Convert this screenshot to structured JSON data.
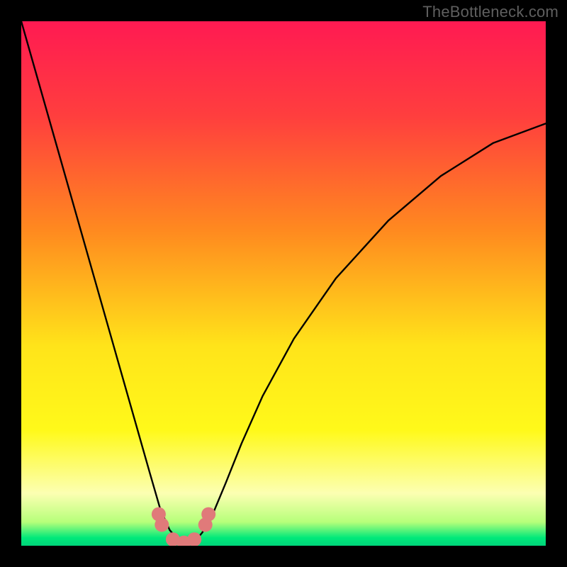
{
  "watermark": "TheBottleneck.com",
  "chart_data": {
    "type": "line",
    "title": "",
    "xlabel": "",
    "ylabel": "",
    "xlim": [
      0,
      1
    ],
    "ylim": [
      0,
      1
    ],
    "grid": false,
    "legend": false,
    "gradient_stops": [
      {
        "pos": 0.0,
        "color": "#ff1a52"
      },
      {
        "pos": 0.18,
        "color": "#ff3e3e"
      },
      {
        "pos": 0.4,
        "color": "#ff8a1f"
      },
      {
        "pos": 0.62,
        "color": "#ffe41a"
      },
      {
        "pos": 0.78,
        "color": "#fff91a"
      },
      {
        "pos": 0.9,
        "color": "#fcffb2"
      },
      {
        "pos": 0.955,
        "color": "#b6ff7a"
      },
      {
        "pos": 0.985,
        "color": "#00e97a"
      },
      {
        "pos": 1.0,
        "color": "#00d47a"
      }
    ],
    "series": [
      {
        "name": "bottleneck-curve",
        "stroke": "#000000",
        "stroke_width": 2.4,
        "x": [
          0.0,
          0.035,
          0.07,
          0.105,
          0.14,
          0.175,
          0.21,
          0.245,
          0.265,
          0.283,
          0.3,
          0.315,
          0.33,
          0.345,
          0.365,
          0.39,
          0.42,
          0.46,
          0.52,
          0.6,
          0.7,
          0.8,
          0.9,
          1.0
        ],
        "y": [
          1.0,
          0.877,
          0.754,
          0.631,
          0.508,
          0.385,
          0.262,
          0.139,
          0.07,
          0.03,
          0.01,
          0.003,
          0.007,
          0.025,
          0.06,
          0.12,
          0.195,
          0.285,
          0.395,
          0.51,
          0.62,
          0.705,
          0.768,
          0.805
        ]
      },
      {
        "name": "marker-dots",
        "type": "scatter",
        "stroke": "#e07a7a",
        "fill": "#e07a7a",
        "radius": 10,
        "x": [
          0.262,
          0.268,
          0.289,
          0.31,
          0.33,
          0.351,
          0.357
        ],
        "y": [
          0.06,
          0.04,
          0.012,
          0.006,
          0.012,
          0.04,
          0.06
        ]
      }
    ]
  }
}
